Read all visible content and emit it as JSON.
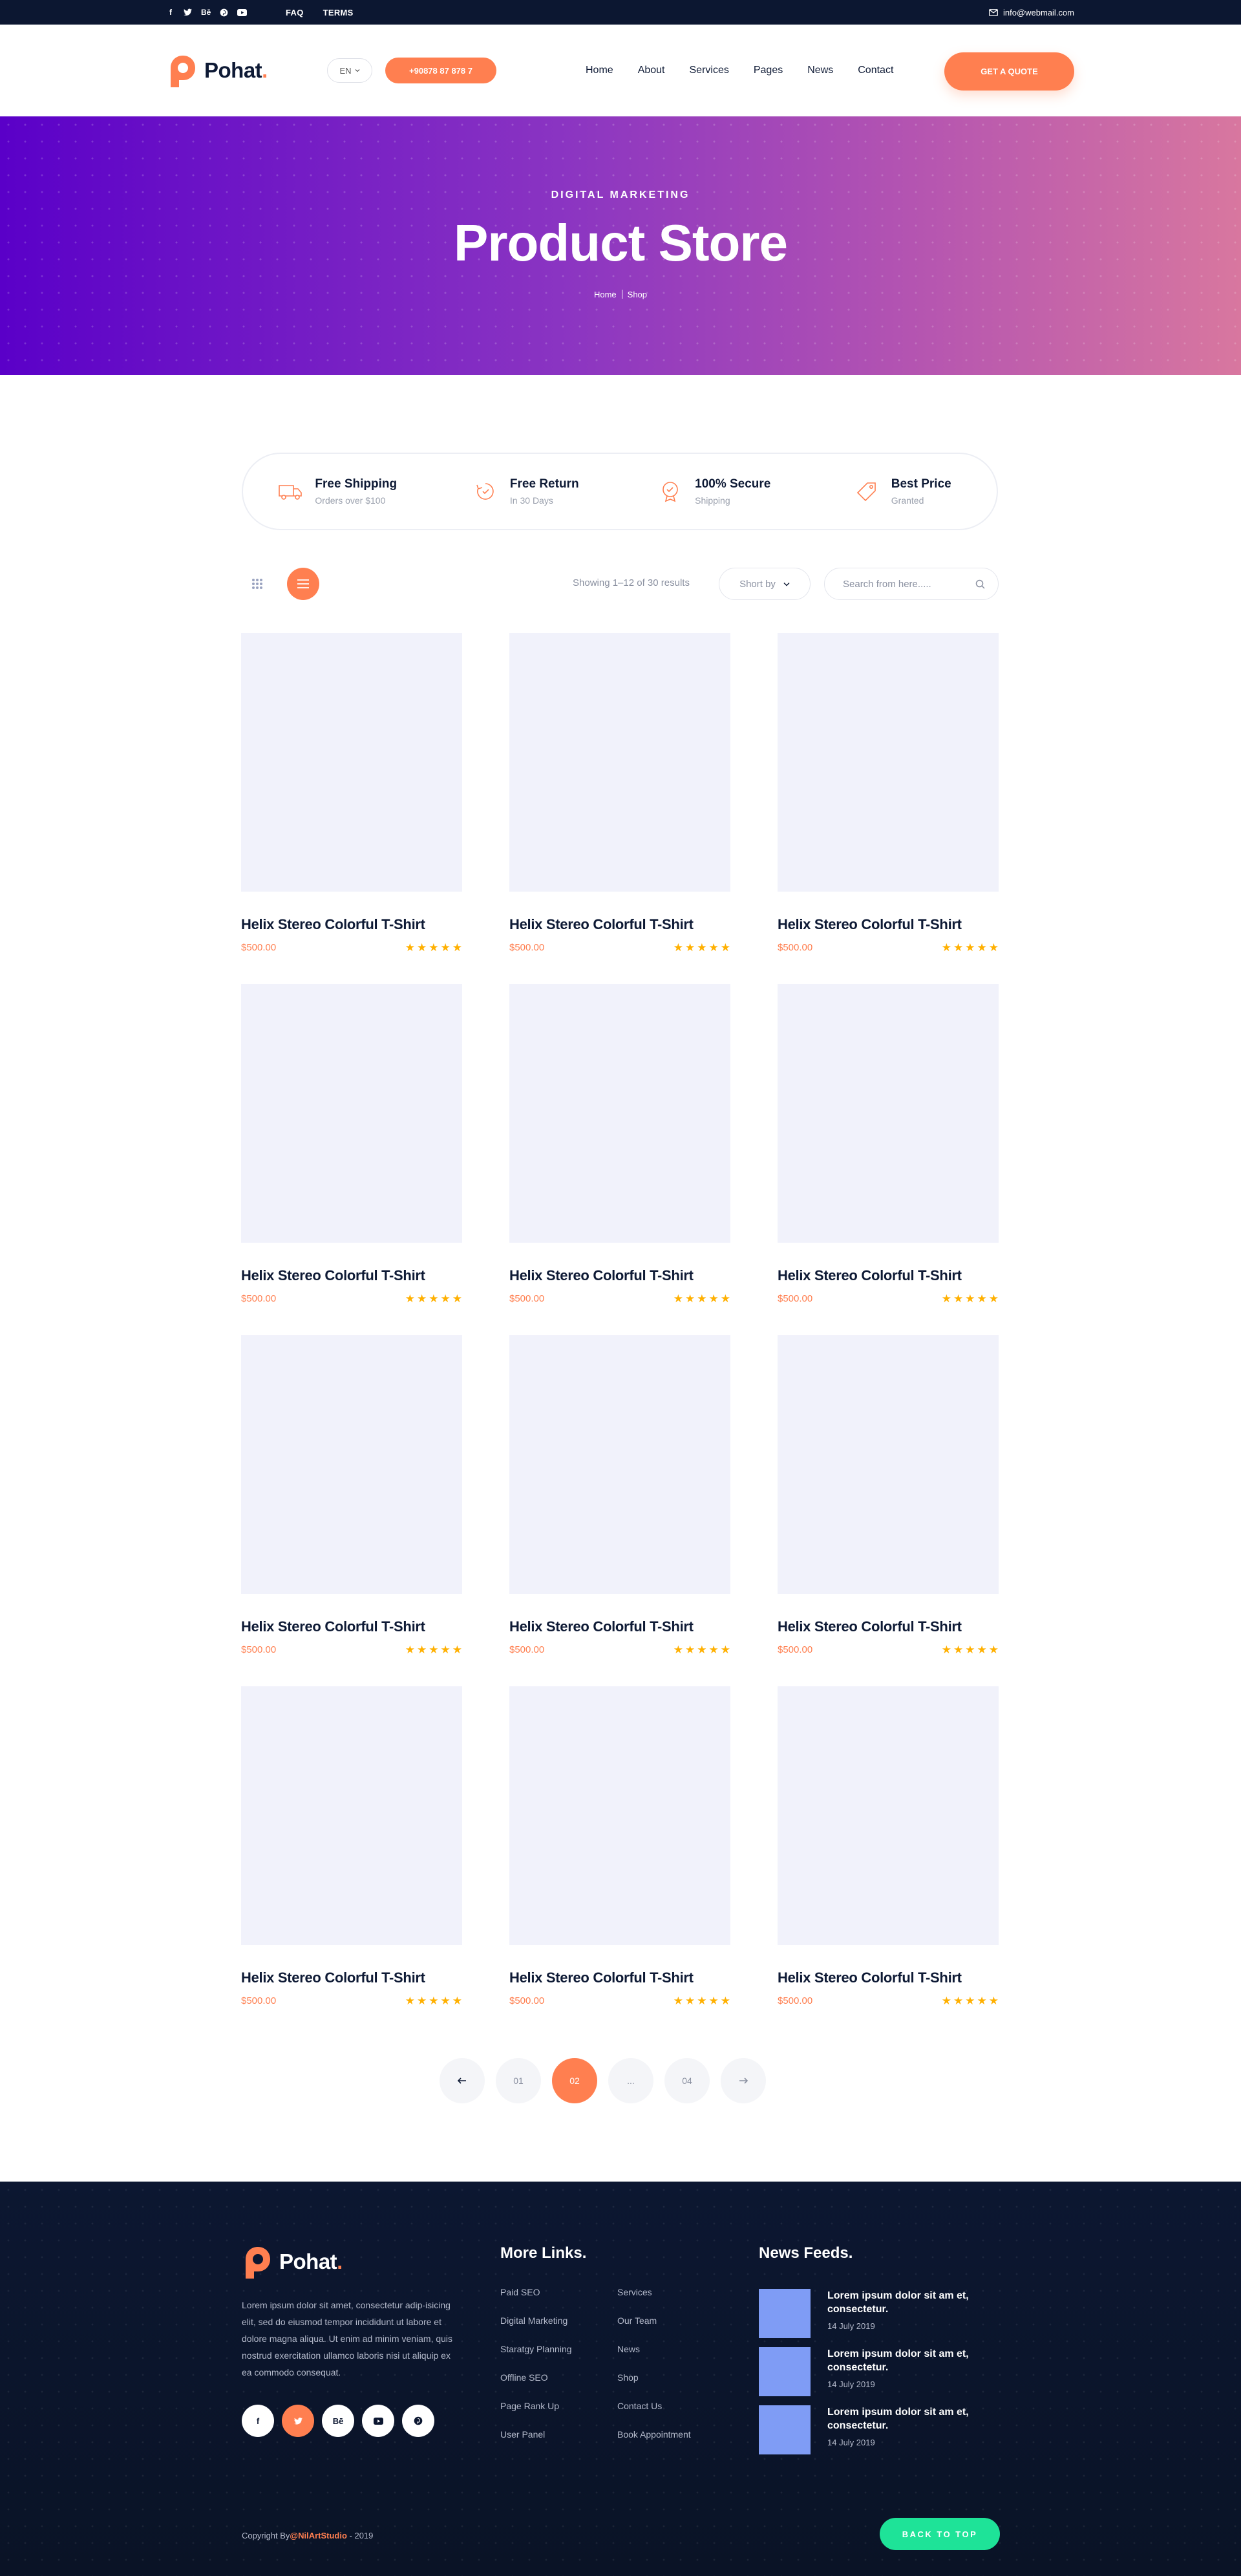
{
  "topbar": {
    "social": [
      {
        "icon": "facebook-icon",
        "glyph": "f"
      },
      {
        "icon": "twitter-icon",
        "glyph": "t"
      },
      {
        "icon": "behance-icon",
        "glyph": "Bē"
      },
      {
        "icon": "pinterest-icon",
        "glyph": "p"
      },
      {
        "icon": "youtube-icon",
        "glyph": "▶"
      }
    ],
    "links": [
      "FAQ",
      "TERMS"
    ],
    "email": "info@webmail.com"
  },
  "header": {
    "logo_text": "Pohat",
    "logo_dot": ".",
    "language": "EN",
    "phone": "+90878 87 878 7",
    "nav": [
      "Home",
      "About",
      "Services",
      "Pages",
      "News",
      "Contact"
    ],
    "cta": "GET A QUOTE"
  },
  "hero": {
    "kicker": "DIGITAL MARKETING",
    "title": "Product Store",
    "breadcrumb": [
      "Home",
      "Shop"
    ]
  },
  "features": [
    {
      "icon": "truck-icon",
      "title": "Free Shipping",
      "subtitle": "Orders over $100"
    },
    {
      "icon": "return-icon",
      "title": "Free Return",
      "subtitle": "In 30 Days"
    },
    {
      "icon": "shield-icon",
      "title": "100% Secure",
      "subtitle": "Shipping"
    },
    {
      "icon": "tag-icon",
      "title": "Best Price",
      "subtitle": "Granted"
    }
  ],
  "toolbar": {
    "showing": "Showing 1–12 of 30 results",
    "sort_label": "Short by",
    "search_placeholder": "Search from here.....",
    "accent": "#ff7f50"
  },
  "products": [
    {
      "name": "Helix Stereo Colorful T-Shirt",
      "price": "$500.00",
      "rating": 5
    },
    {
      "name": "Helix Stereo Colorful T-Shirt",
      "price": "$500.00",
      "rating": 5
    },
    {
      "name": "Helix Stereo Colorful T-Shirt",
      "price": "$500.00",
      "rating": 5
    },
    {
      "name": "Helix Stereo Colorful T-Shirt",
      "price": "$500.00",
      "rating": 5
    },
    {
      "name": "Helix Stereo Colorful T-Shirt",
      "price": "$500.00",
      "rating": 5
    },
    {
      "name": "Helix Stereo Colorful T-Shirt",
      "price": "$500.00",
      "rating": 5
    },
    {
      "name": "Helix Stereo Colorful T-Shirt",
      "price": "$500.00",
      "rating": 5
    },
    {
      "name": "Helix Stereo Colorful T-Shirt",
      "price": "$500.00",
      "rating": 5
    },
    {
      "name": "Helix Stereo Colorful T-Shirt",
      "price": "$500.00",
      "rating": 5
    },
    {
      "name": "Helix Stereo Colorful T-Shirt",
      "price": "$500.00",
      "rating": 5
    },
    {
      "name": "Helix Stereo Colorful T-Shirt",
      "price": "$500.00",
      "rating": 5
    },
    {
      "name": "Helix Stereo Colorful T-Shirt",
      "price": "$500.00",
      "rating": 5
    }
  ],
  "pagination": {
    "pages": [
      "01",
      "02",
      "...",
      "04"
    ],
    "current": "02"
  },
  "footer": {
    "logo_text": "Pohat",
    "logo_dot": ".",
    "about": "Lorem ipsum dolor sit amet, consectetur adip-isicing elit, sed do eiusmod tempor incididunt ut labore et dolore magna aliqua. Ut enim ad minim veniam, quis nostrud exercitation ullamco laboris nisi ut aliquip ex ea commodo consequat.",
    "social": [
      {
        "icon": "facebook-icon",
        "glyph": "f"
      },
      {
        "icon": "twitter-icon",
        "glyph": "t"
      },
      {
        "icon": "behance-icon",
        "glyph": "Bē"
      },
      {
        "icon": "youtube-icon",
        "glyph": "▶"
      },
      {
        "icon": "pinterest-icon",
        "glyph": "p"
      }
    ],
    "links_title": "More Links.",
    "links_col1": [
      "Paid SEO",
      "Digital Marketing",
      "Staratgy Planning",
      "Offline SEO",
      "Page Rank Up",
      "User Panel"
    ],
    "links_col2": [
      "Services",
      "Our Team",
      "News",
      "Shop",
      "Contact Us",
      "Book Appointment"
    ],
    "news_title": "News Feeds.",
    "news": [
      {
        "title": "Lorem ipsum dolor sit am et, consectetur.",
        "date": "14 July 2019"
      },
      {
        "title": "Lorem ipsum dolor sit am et, consectetur.",
        "date": "14 July 2019"
      },
      {
        "title": "Lorem ipsum dolor sit am et, consectetur.",
        "date": "14 July 2019"
      }
    ],
    "copyright_prefix": "Copyright By",
    "copyright_brand": "@NilArtStudio",
    "copyright_suffix": " - 2019",
    "back_to_top": "BACK TO TOP"
  }
}
